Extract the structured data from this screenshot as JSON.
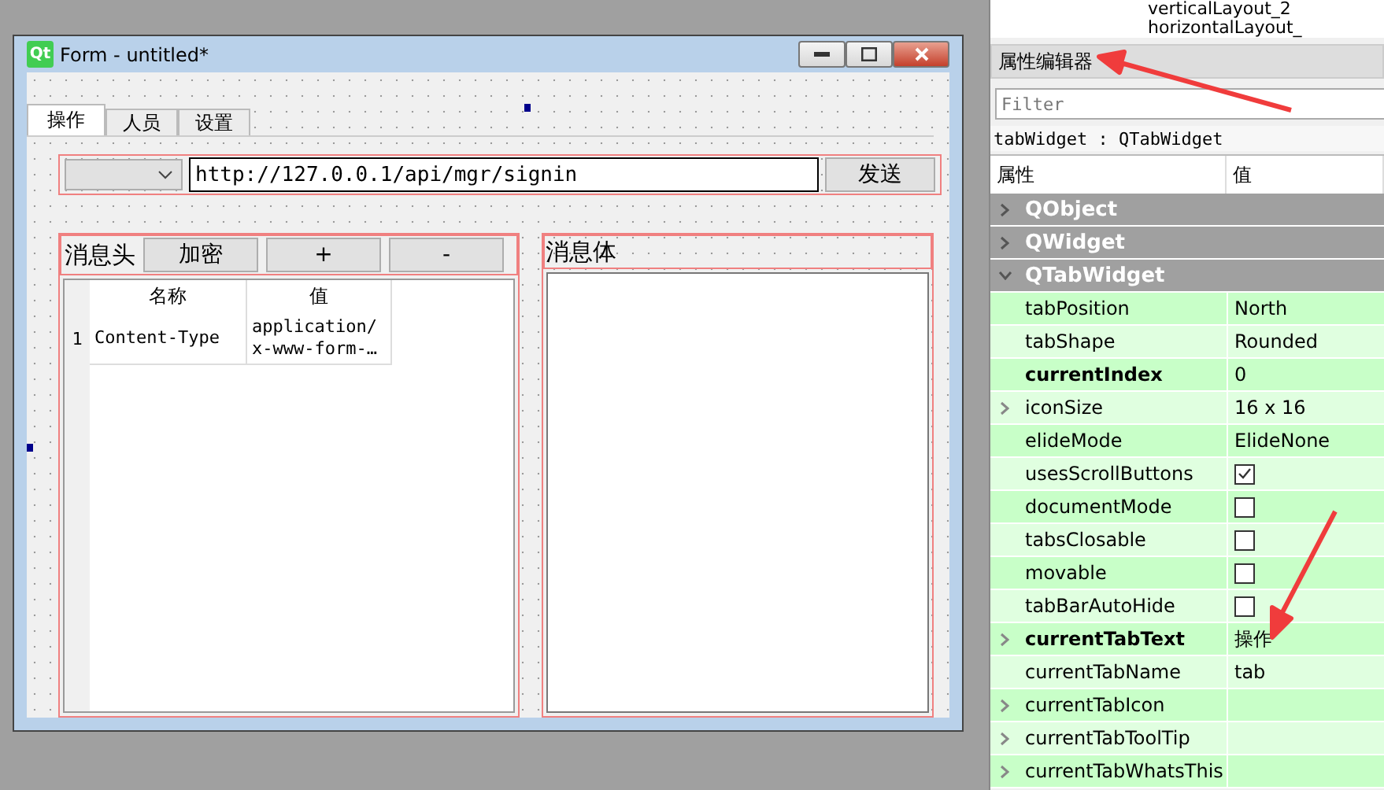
{
  "form_window": {
    "logo": "Qt",
    "title": "Form - untitled*",
    "tabs": [
      {
        "label": "操作",
        "selected": true
      },
      {
        "label": "人员",
        "selected": false
      },
      {
        "label": "设置",
        "selected": false
      }
    ],
    "url_field": {
      "value": "http://127.0.0.1/api/mgr/signin"
    },
    "send_button": "发送",
    "header_panel": {
      "label": "消息头",
      "buttons": [
        "加密",
        "+",
        "-"
      ],
      "table": {
        "columns": [
          "名称",
          "值"
        ],
        "rows": [
          {
            "row_header": "1",
            "cells": [
              "Content-Type",
              "application/x-www-form-…"
            ]
          }
        ]
      }
    },
    "body_panel": {
      "label": "消息体"
    }
  },
  "object_inspector": {
    "items": [
      "verticalLayout_2",
      "horizontalLayout_"
    ]
  },
  "property_editor": {
    "title": "属性编辑器",
    "filter": {
      "placeholder": "Filter"
    },
    "object_label": "tabWidget : QTabWidget",
    "columns": [
      "属性",
      "值"
    ],
    "groups": [
      {
        "name": "QObject",
        "expanded": false
      },
      {
        "name": "QWidget",
        "expanded": false
      },
      {
        "name": "QTabWidget",
        "expanded": true,
        "properties": [
          {
            "name": "tabPosition",
            "kind": "text",
            "value": "North",
            "modified": false,
            "expandable": false
          },
          {
            "name": "tabShape",
            "kind": "text",
            "value": "Rounded",
            "modified": false,
            "expandable": false
          },
          {
            "name": "currentIndex",
            "kind": "text",
            "value": "0",
            "modified": true,
            "expandable": false
          },
          {
            "name": "iconSize",
            "kind": "text",
            "value": "16 x 16",
            "modified": false,
            "expandable": true
          },
          {
            "name": "elideMode",
            "kind": "text",
            "value": "ElideNone",
            "modified": false,
            "expandable": false
          },
          {
            "name": "usesScrollButtons",
            "kind": "check",
            "checked": true,
            "modified": false,
            "expandable": false
          },
          {
            "name": "documentMode",
            "kind": "check",
            "checked": false,
            "modified": false,
            "expandable": false
          },
          {
            "name": "tabsClosable",
            "kind": "check",
            "checked": false,
            "modified": false,
            "expandable": false
          },
          {
            "name": "movable",
            "kind": "check",
            "checked": false,
            "modified": false,
            "expandable": false
          },
          {
            "name": "tabBarAutoHide",
            "kind": "check",
            "checked": false,
            "modified": false,
            "expandable": false
          },
          {
            "name": "currentTabText",
            "kind": "text",
            "value": "操作",
            "modified": true,
            "expandable": true
          },
          {
            "name": "currentTabName",
            "kind": "text",
            "value": "tab",
            "modified": false,
            "expandable": false
          },
          {
            "name": "currentTabIcon",
            "kind": "text",
            "modified": false,
            "expandable": true
          },
          {
            "name": "currentTabToolTip",
            "kind": "text",
            "modified": false,
            "expandable": true
          },
          {
            "name": "currentTabWhatsThis",
            "kind": "text",
            "modified": false,
            "expandable": true
          }
        ]
      }
    ]
  }
}
